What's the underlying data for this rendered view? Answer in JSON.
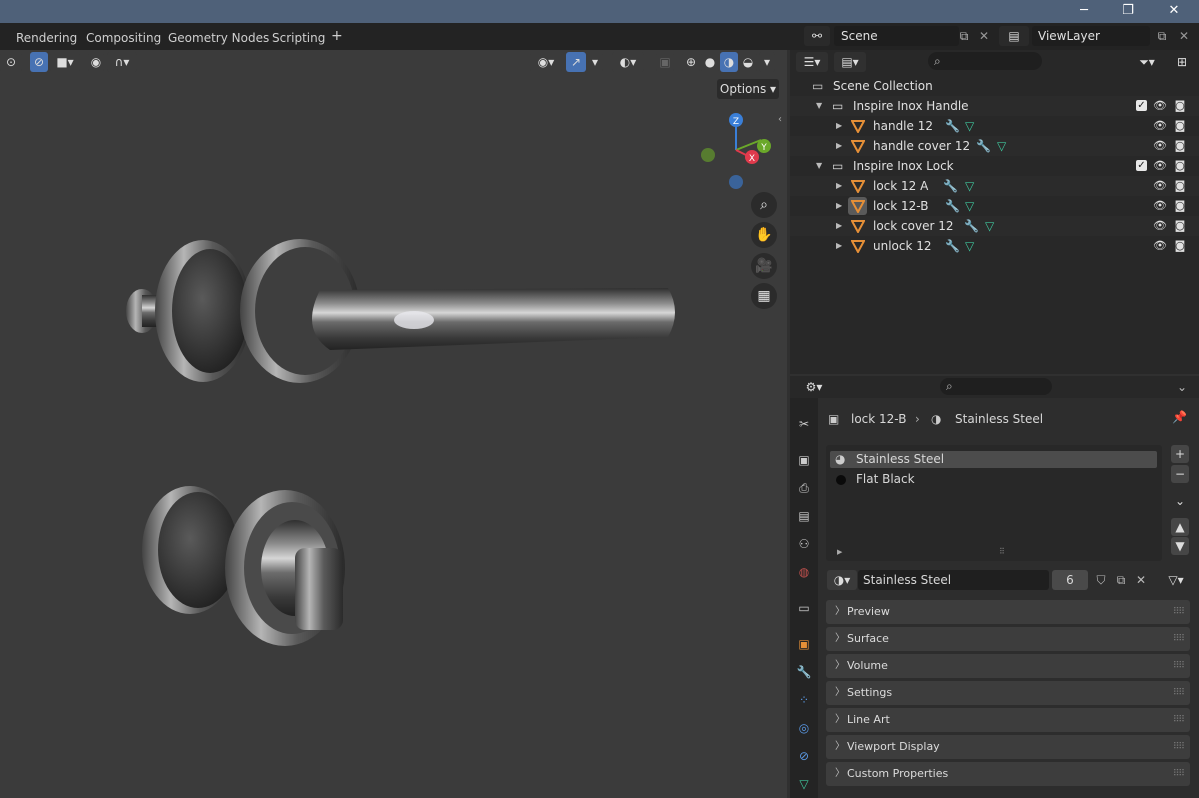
{
  "window": {
    "minimize": "─",
    "maximize": "❐",
    "close": "✕"
  },
  "workspace_tabs": [
    "Rendering",
    "Compositing",
    "Geometry Nodes",
    "Scripting"
  ],
  "add_tab": "+",
  "scene_field": "Scene",
  "view_layer_field": "ViewLayer",
  "viewport": {
    "options_label": "Options",
    "gizmo": {
      "z": "Z",
      "y": "Y",
      "x": "X"
    }
  },
  "outliner": {
    "root": "Scene Collection",
    "collections": [
      {
        "name": "Inspire Inox Handle",
        "objects": [
          "handle 12",
          "handle cover 12"
        ]
      },
      {
        "name": "Inspire Inox Lock",
        "objects": [
          "lock 12 A",
          "lock 12-B",
          "lock cover 12",
          "unlock 12"
        ]
      }
    ]
  },
  "properties": {
    "breadcrumb_object": "lock 12-B",
    "breadcrumb_material": "Stainless Steel",
    "material_slots": [
      "Stainless Steel",
      "Flat Black"
    ],
    "material_name": "Stainless Steel",
    "user_count": "6",
    "panels": [
      "Preview",
      "Surface",
      "Volume",
      "Settings",
      "Line Art",
      "Viewport Display",
      "Custom Properties"
    ]
  },
  "colors": {
    "accent": "#4772b3",
    "object_icon": "#e58f37",
    "modifier_icon": "#5b9ae6",
    "mesh_icon": "#3fc59c"
  }
}
